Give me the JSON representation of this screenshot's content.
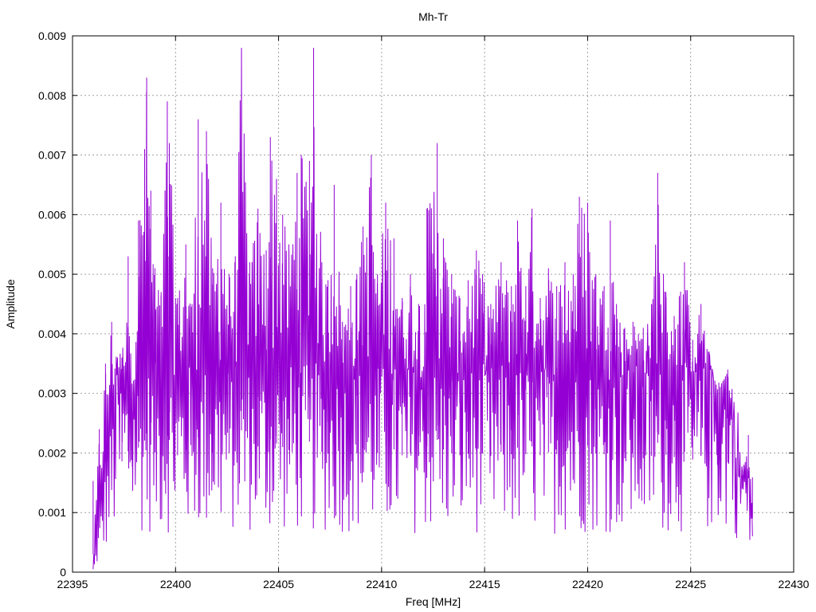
{
  "chart_data": {
    "type": "line",
    "title": "Mh-Tr",
    "xlabel": "Freq [MHz]",
    "ylabel": "Amplitude",
    "xlim": [
      22395,
      22430
    ],
    "ylim": [
      0,
      0.009
    ],
    "xticks": [
      "22395",
      "22400",
      "22405",
      "22410",
      "22415",
      "22420",
      "22425",
      "22430"
    ],
    "yticks": [
      "0",
      "0.001",
      "0.002",
      "0.003",
      "0.004",
      "0.005",
      "0.006",
      "0.007",
      "0.008",
      "0.009"
    ],
    "grid": true,
    "colors": {
      "series": "#9400d3",
      "grid": "#a0a0a0",
      "frame": "#000000"
    },
    "series": [
      {
        "x_start": 22396.0,
        "x_end": 22428.0,
        "x_step": 0.032,
        "points": 1001,
        "peaks": [
          [
            22396.0,
            0.0003
          ],
          [
            22396.3,
            0.0024
          ],
          [
            22396.6,
            0.0035
          ],
          [
            22396.9,
            0.0042
          ],
          [
            22397.4,
            0.0036
          ],
          [
            22397.7,
            0.0053
          ],
          [
            22397.9,
            0.0027
          ],
          [
            22398.2,
            0.0059
          ],
          [
            22398.5,
            0.0071
          ],
          [
            22398.6,
            0.0083
          ],
          [
            22398.8,
            0.0064
          ],
          [
            22399.0,
            0.0051
          ],
          [
            22399.3,
            0.0047
          ],
          [
            22399.6,
            0.0079
          ],
          [
            22399.7,
            0.0072
          ],
          [
            22400.1,
            0.0046
          ],
          [
            22400.5,
            0.0055
          ],
          [
            22400.8,
            0.0045
          ],
          [
            22401.1,
            0.0076
          ],
          [
            22401.5,
            0.0074
          ],
          [
            22401.8,
            0.0051
          ],
          [
            22402.2,
            0.0062
          ],
          [
            22402.6,
            0.005
          ],
          [
            22402.9,
            0.0053
          ],
          [
            22403.2,
            0.0088
          ],
          [
            22403.6,
            0.0052
          ],
          [
            22404.0,
            0.0061
          ],
          [
            22404.4,
            0.0054
          ],
          [
            22404.6,
            0.0073
          ],
          [
            22404.9,
            0.0066
          ],
          [
            22405.2,
            0.006
          ],
          [
            22405.5,
            0.0055
          ],
          [
            22405.9,
            0.0067
          ],
          [
            22406.1,
            0.007
          ],
          [
            22406.5,
            0.0069
          ],
          [
            22406.7,
            0.0088
          ],
          [
            22407.1,
            0.0052
          ],
          [
            22407.4,
            0.0049
          ],
          [
            22407.7,
            0.0065
          ],
          [
            22408.1,
            0.0042
          ],
          [
            22408.5,
            0.0048
          ],
          [
            22408.8,
            0.005
          ],
          [
            22409.1,
            0.0058
          ],
          [
            22409.5,
            0.007
          ],
          [
            22409.8,
            0.005
          ],
          [
            22410.2,
            0.0062
          ],
          [
            22410.6,
            0.0056
          ],
          [
            22411.0,
            0.0046
          ],
          [
            22411.4,
            0.005
          ],
          [
            22411.8,
            0.0045
          ],
          [
            22412.2,
            0.0061
          ],
          [
            22412.7,
            0.0072
          ],
          [
            22413.0,
            0.0056
          ],
          [
            22413.4,
            0.005
          ],
          [
            22413.8,
            0.0046
          ],
          [
            22414.2,
            0.0049
          ],
          [
            22414.6,
            0.0054
          ],
          [
            22414.9,
            0.005
          ],
          [
            22415.3,
            0.0045
          ],
          [
            22415.8,
            0.0052
          ],
          [
            22416.3,
            0.0048
          ],
          [
            22416.6,
            0.0059
          ],
          [
            22417.0,
            0.0048
          ],
          [
            22417.3,
            0.0061
          ],
          [
            22417.7,
            0.0046
          ],
          [
            22418.1,
            0.0051
          ],
          [
            22418.5,
            0.0048
          ],
          [
            22418.9,
            0.0052
          ],
          [
            22419.3,
            0.005
          ],
          [
            22419.6,
            0.0063
          ],
          [
            22420.0,
            0.0062
          ],
          [
            22420.4,
            0.005
          ],
          [
            22420.8,
            0.0048
          ],
          [
            22421.1,
            0.0059
          ],
          [
            22421.4,
            0.0045
          ],
          [
            22421.8,
            0.0041
          ],
          [
            22422.2,
            0.0042
          ],
          [
            22422.7,
            0.0041
          ],
          [
            22423.1,
            0.0045
          ],
          [
            22423.4,
            0.0067
          ],
          [
            22423.8,
            0.0047
          ],
          [
            22424.2,
            0.0043
          ],
          [
            22424.7,
            0.0052
          ],
          [
            22425.1,
            0.0039
          ],
          [
            22425.5,
            0.0045
          ],
          [
            22425.9,
            0.0037
          ],
          [
            22426.3,
            0.003
          ],
          [
            22426.8,
            0.0034
          ],
          [
            22427.2,
            0.0016
          ],
          [
            22427.5,
            0.0014
          ],
          [
            22427.8,
            0.0023
          ],
          [
            22428.0,
            0.0009
          ]
        ]
      }
    ]
  }
}
